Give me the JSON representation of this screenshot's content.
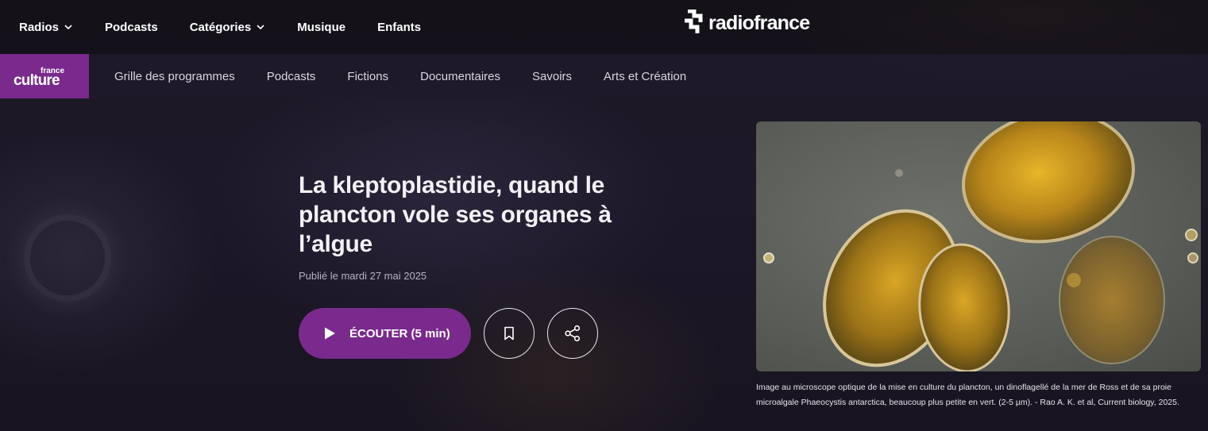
{
  "top_nav": {
    "items": [
      {
        "label": "Radios",
        "has_dropdown": true
      },
      {
        "label": "Podcasts",
        "has_dropdown": false
      },
      {
        "label": "Catégories",
        "has_dropdown": true
      },
      {
        "label": "Musique",
        "has_dropdown": false
      },
      {
        "label": "Enfants",
        "has_dropdown": false
      }
    ],
    "brand": "radiofrance"
  },
  "station": {
    "logo_small": "france",
    "logo_big": "culture",
    "brand_color": "#7a2a8c"
  },
  "sub_nav": {
    "items": [
      {
        "label": "Grille des programmes"
      },
      {
        "label": "Podcasts"
      },
      {
        "label": "Fictions"
      },
      {
        "label": "Documentaires"
      },
      {
        "label": "Savoirs"
      },
      {
        "label": "Arts et Création"
      }
    ]
  },
  "article": {
    "title": "La kleptoplastidie, quand le plancton vole ses organes à l’algue",
    "published": "Publié le mardi 27 mai 2025",
    "listen_label": "ÉCOUTER",
    "listen_duration": "(5 min)",
    "bookmark_icon": "bookmark-icon",
    "share_icon": "share-icon"
  },
  "image": {
    "caption": "Image au microscope optique de la mise en culture du plancton, un dinoflagellé de la mer de Ross et de sa proie microalgale Phaeocystis antarctica, beaucoup plus petite en vert. (2-5 µm). - Rao A. K. et al, Current biology, 2025."
  }
}
